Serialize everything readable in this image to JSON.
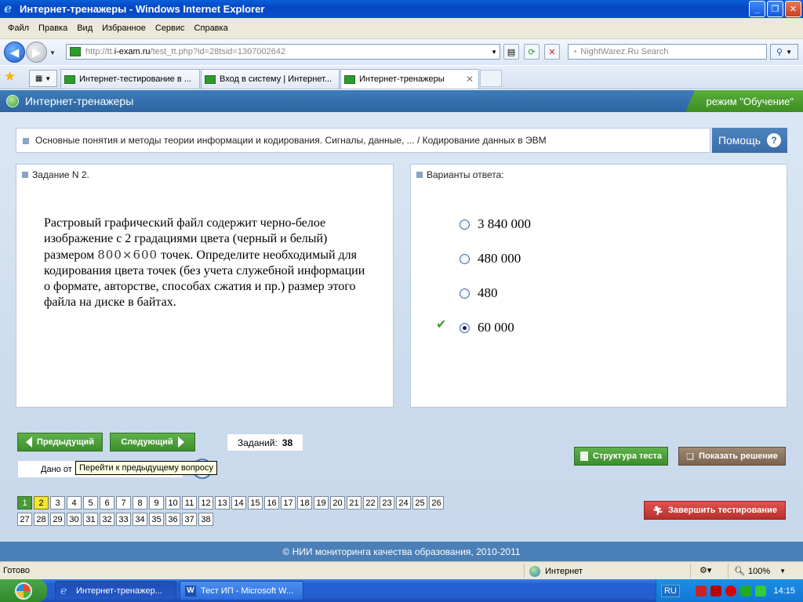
{
  "window": {
    "title": "Интернет-тренажеры - Windows Internet Explorer"
  },
  "menu": [
    "Файл",
    "Правка",
    "Вид",
    "Избранное",
    "Сервис",
    "Справка"
  ],
  "address": {
    "prefix": "http://tt.",
    "host": "i-exam.ru",
    "path": "/test_tt.php?id=28tsid=1307002642"
  },
  "search": {
    "placeholder": "NightWarez.Ru Search"
  },
  "tabs": [
    {
      "label": "Интернет-тестирование в ..."
    },
    {
      "label": "Вход в систему | Интернет..."
    },
    {
      "label": "Интернет-тренажеры"
    }
  ],
  "header": {
    "site_title": "Интернет-тренажеры",
    "mode": "режим \"Обучение\""
  },
  "breadcrumb": "Основные понятия и методы теории информации и кодирования. Сигналы, данные, ... / Кодирование данных в ЭВМ",
  "help_label": "Помощь",
  "task": {
    "heading": "Задание N 2.",
    "text_before": "Растровый графический файл содержит черно-белое изображение с 2 градациями цвета (черный и белый) размером",
    "dims": "800×600",
    "text_after": "точек. Определите необходимый для кодирования цвета точек (без учета служебной информации о формате, авторстве, способах сжатия и пр.) размер этого файла на диске в байтах."
  },
  "answers": {
    "heading": "Варианты ответа:",
    "options": [
      {
        "label": "3 840 000",
        "selected": false
      },
      {
        "label": "480 000",
        "selected": false
      },
      {
        "label": "480",
        "selected": false
      },
      {
        "label": "60 000",
        "selected": true,
        "correct": true
      }
    ]
  },
  "controls": {
    "prev": "Предыдущий",
    "next": "Следующий",
    "count_label": "Заданий:",
    "count_value": "38",
    "dano_label": "Дано от",
    "tooltip": "Перейти к предыдущему вопросу",
    "structure": "Структура теста",
    "show_solution": "Показать решение",
    "finish": "Завершить тестирование"
  },
  "questions": {
    "numbers": [
      "1",
      "2",
      "3",
      "4",
      "5",
      "6",
      "7",
      "8",
      "9",
      "10",
      "11",
      "12",
      "13",
      "14",
      "15",
      "16",
      "17",
      "18",
      "19",
      "20",
      "21",
      "22",
      "23",
      "24",
      "25",
      "26",
      "27",
      "28",
      "29",
      "30",
      "31",
      "32",
      "33",
      "34",
      "35",
      "36",
      "37",
      "38"
    ],
    "done": [
      "1"
    ],
    "current": "2"
  },
  "footer": "© НИИ мониторинга качества образования, 2010-2011",
  "statusbar": {
    "status": "Готово",
    "zone": "Интернет",
    "zoom": "100%"
  },
  "taskbar": {
    "items": [
      {
        "label": "Интернет-тренажер..."
      },
      {
        "label": "Тест ИП - Microsoft W..."
      }
    ],
    "lang": "RU",
    "clock": "14:15"
  },
  "colors": {
    "accent_blue": "#2d65a2",
    "green_button": "#3d8f2c",
    "current_question": "#f4e536",
    "done_question": "#4a9a3a",
    "finish_red": "#b8302c"
  }
}
